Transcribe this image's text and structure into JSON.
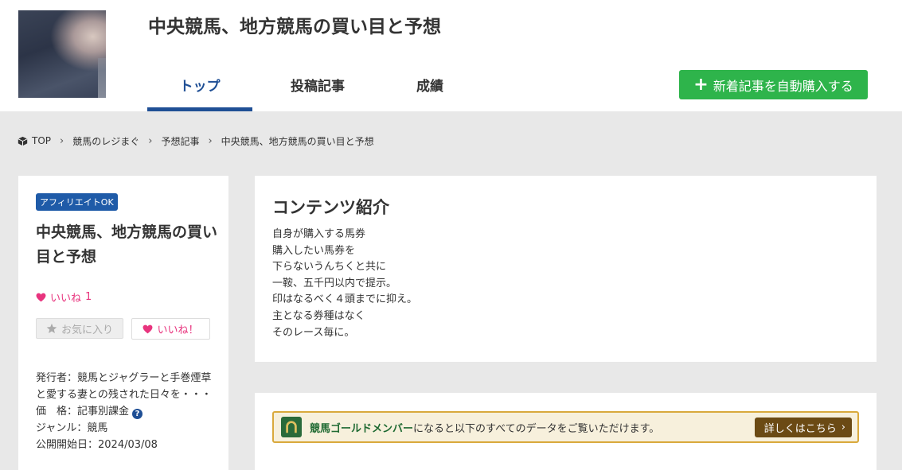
{
  "header": {
    "site_title": "中央競馬、地方競馬の買い目と予想",
    "tabs": [
      {
        "label": "トップ",
        "active": true
      },
      {
        "label": "投稿記事",
        "active": false
      },
      {
        "label": "成績",
        "active": false
      }
    ],
    "buy_button_label": "新着記事を自動購入する",
    "accent_color": "#1f4f95",
    "buy_button_color": "#2eb44b"
  },
  "breadcrumb": [
    "TOP",
    "競馬のレジまぐ",
    "予想記事",
    "中央競馬、地方競馬の買い目と予想"
  ],
  "left_card": {
    "badge": "アフィリエイトOK",
    "title": "中央競馬、地方競馬の買い目と予想",
    "like_label": "いいね",
    "like_count": "1",
    "favorite_button": "お気に入り",
    "like_button": "いいね！",
    "meta": {
      "publisher_label": "発行者：",
      "publisher": "競馬とジャグラーと手巻煙草と愛する妻との残された日々を・・・",
      "price_label": "価　格：",
      "price": "記事別課金",
      "genre_label": "ジャンル：",
      "genre": "競馬",
      "start_label": "公開開始日：",
      "start_date": "2024/03/08"
    }
  },
  "content": {
    "heading": "コンテンツ紹介",
    "lines": [
      "自身が購入する馬券",
      "購入したい馬券を",
      "下らないうんちくと共に",
      "一鞍、五千円以内で提示。",
      "印はなるべく４頭までに抑え。",
      "主となる券種はなく",
      "そのレース毎に。"
    ]
  },
  "gold": {
    "strong": "競馬ゴールドメンバー",
    "text": "になると以下のすべてのデータをご覧いただけます。",
    "button": "詳しくはこちら"
  }
}
